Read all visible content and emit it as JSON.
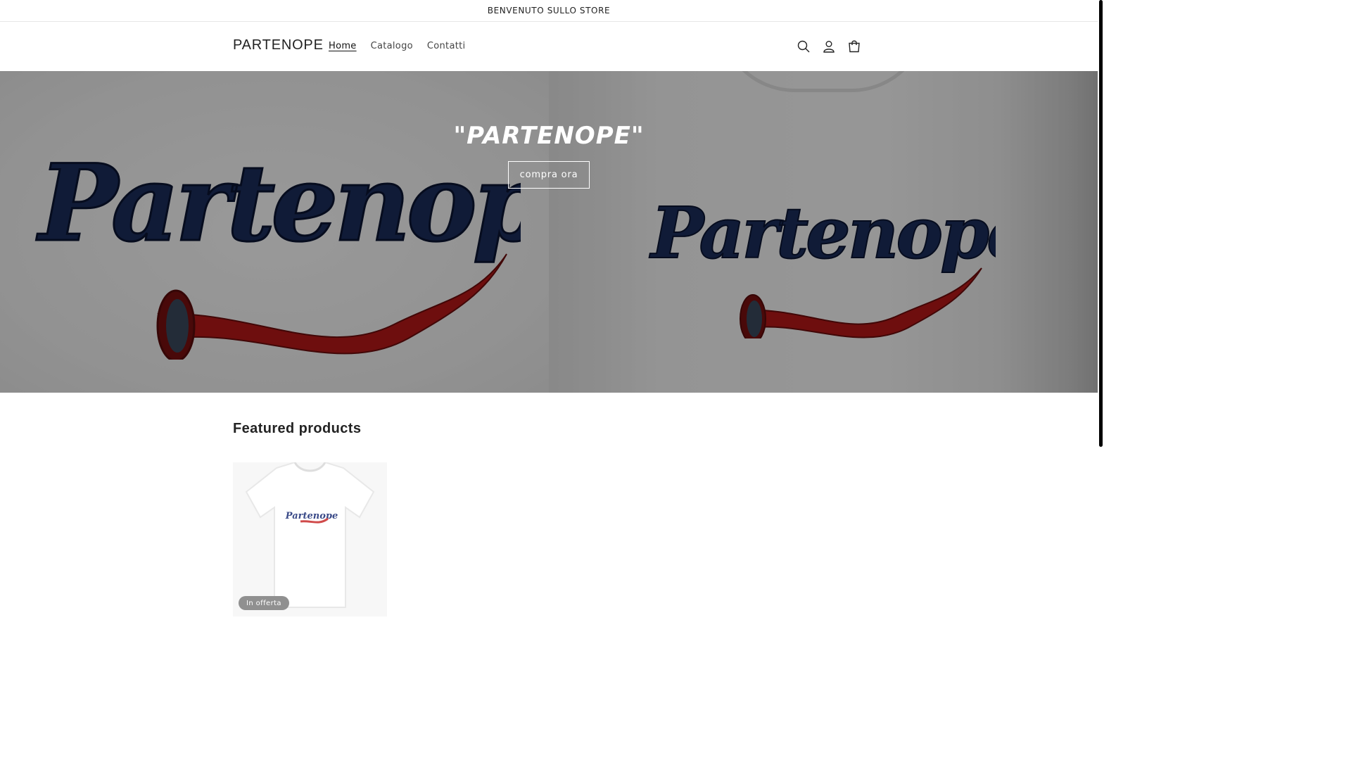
{
  "announcement": {
    "text": "BENVENUTO SULLO STORE"
  },
  "header": {
    "logo": "PARTENOPE",
    "nav": [
      {
        "label": "Home",
        "active": true
      },
      {
        "label": "Catalogo",
        "active": false
      },
      {
        "label": "Contatti",
        "active": false
      }
    ],
    "icons": [
      "search-icon",
      "account-icon",
      "cart-icon"
    ]
  },
  "hero": {
    "title": "\"PARTENOPE\"",
    "button_label": "compra ora",
    "colors": {
      "script_navy": "#1c2e5c",
      "horn_red": "#b81818",
      "overlay": "rgba(0,0,0,0.40)"
    }
  },
  "featured": {
    "title": "Featured products",
    "products": [
      {
        "badge": "In offerta"
      }
    ]
  }
}
